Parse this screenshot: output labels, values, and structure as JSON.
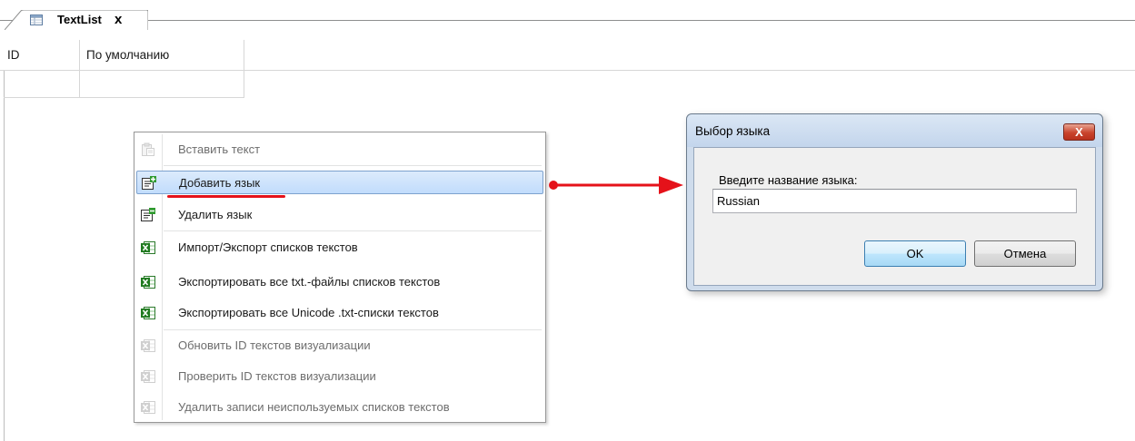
{
  "editor_tab": {
    "label": "TextList",
    "close_glyph": "x",
    "icon": "table-icon"
  },
  "table": {
    "columns": [
      "ID",
      "По умолчанию"
    ],
    "rows": [
      [
        "",
        ""
      ]
    ]
  },
  "context_menu": {
    "items": [
      {
        "label": "Вставить текст",
        "enabled": false,
        "icon": "paste-text-icon"
      },
      {
        "label": "Добавить язык",
        "enabled": true,
        "highlighted": true,
        "icon": "add-language-icon"
      },
      {
        "label": "Удалить язык",
        "enabled": true,
        "icon": "remove-language-icon"
      },
      {
        "label": "Импорт/Экспорт списков текстов",
        "enabled": true,
        "icon": "excel-icon"
      },
      {
        "label": "Экспортировать все txt.-файлы списков текстов",
        "enabled": true,
        "icon": "excel-icon"
      },
      {
        "label": "Экспортировать все Unicode .txt-списки текстов",
        "enabled": true,
        "icon": "excel-icon"
      },
      {
        "label": "Обновить ID текстов визуализации",
        "enabled": false,
        "icon": "excel-icon"
      },
      {
        "label": "Проверить ID текстов визуализации",
        "enabled": false,
        "icon": "excel-icon"
      },
      {
        "label": "Удалить записи неиспользуемых списков текстов",
        "enabled": false,
        "icon": "excel-icon"
      }
    ]
  },
  "annotation": {
    "arrow_color": "#e5121a",
    "arrow_icon": "right-arrow-icon"
  },
  "dialog": {
    "title": "Выбор языка",
    "close_glyph": "X",
    "prompt": "Введите название языка:",
    "input_value": "Russian",
    "ok_label": "OK",
    "cancel_label": "Отмена"
  }
}
